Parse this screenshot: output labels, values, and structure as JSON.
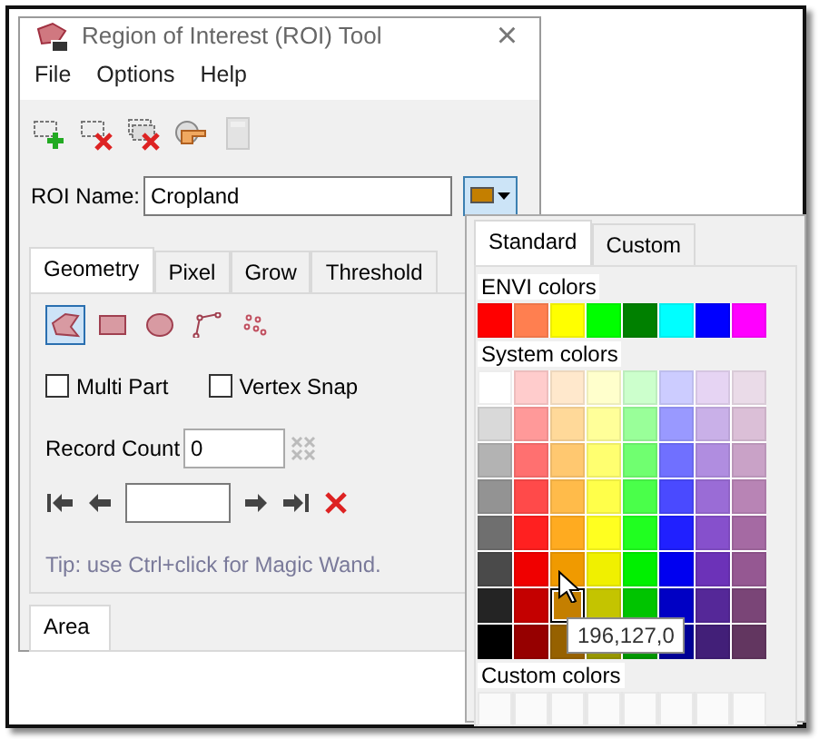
{
  "window": {
    "title": "Region of Interest (ROI) Tool",
    "close": "×"
  },
  "menu": [
    {
      "label": "File"
    },
    {
      "label": "Options"
    },
    {
      "label": "Help"
    }
  ],
  "toolbar": [
    {
      "kind": "new",
      "disabled": false
    },
    {
      "kind": "delete",
      "disabled": false
    },
    {
      "kind": "delete-all",
      "disabled": false
    },
    {
      "kind": "hand",
      "disabled": false
    },
    {
      "kind": "calculator",
      "disabled": true
    }
  ],
  "roi_name": {
    "label": "ROI Name:",
    "value": "Cropland",
    "color": "#c47f00"
  },
  "tabs": [
    {
      "label": "Geometry",
      "selected": true
    },
    {
      "label": "Pixel",
      "selected": false
    },
    {
      "label": "Grow",
      "selected": false
    },
    {
      "label": "Threshold",
      "selected": false
    }
  ],
  "geometry_tools": [
    {
      "kind": "polygon",
      "selected": true
    },
    {
      "kind": "rectangle",
      "selected": false
    },
    {
      "kind": "ellipse",
      "selected": false
    },
    {
      "kind": "polyline",
      "selected": false
    },
    {
      "kind": "point",
      "selected": false
    }
  ],
  "checkboxes": [
    {
      "label": "Multi Part",
      "checked": false
    },
    {
      "label": "Vertex Snap",
      "checked": false
    }
  ],
  "record_count": {
    "label": "Record Count",
    "value": "0"
  },
  "navigation": [
    {
      "kind": "first"
    },
    {
      "kind": "prev"
    },
    {
      "kind": "field"
    },
    {
      "kind": "next"
    },
    {
      "kind": "last"
    },
    {
      "kind": "delete"
    }
  ],
  "tip": "Tip: use Ctrl+click for Magic Wand.",
  "bottom_tabs": [
    {
      "label": "Area",
      "selected": true
    }
  ],
  "palette": {
    "tabs": [
      {
        "label": "Standard",
        "selected": true
      },
      {
        "label": "Custom",
        "selected": false
      }
    ],
    "envi_label": "ENVI colors",
    "envi_colors": [
      {
        "color": "#ff0000"
      },
      {
        "color": "#ff7f50"
      },
      {
        "color": "#ffff00"
      },
      {
        "color": "#00ff00"
      },
      {
        "color": "#008000"
      },
      {
        "color": "#00ffff"
      },
      {
        "color": "#0000ff"
      },
      {
        "color": "#ff00ff"
      }
    ],
    "system_label": "System colors",
    "system_colors": [
      [
        {
          "color": "#ffffff",
          "selected": false
        },
        {
          "color": "#ffcccc",
          "selected": false
        },
        {
          "color": "#ffe8cc",
          "selected": false
        },
        {
          "color": "#ffffcc",
          "selected": false
        },
        {
          "color": "#ccffcc",
          "selected": false
        },
        {
          "color": "#ccccff",
          "selected": false
        },
        {
          "color": "#e6d4f3",
          "selected": false
        },
        {
          "color": "#eadbe8",
          "selected": false
        }
      ],
      [
        {
          "color": "#d9d9d9",
          "selected": false
        },
        {
          "color": "#ff9999",
          "selected": false
        },
        {
          "color": "#ffd999",
          "selected": false
        },
        {
          "color": "#ffff99",
          "selected": false
        },
        {
          "color": "#99ff99",
          "selected": false
        },
        {
          "color": "#9999ff",
          "selected": false
        },
        {
          "color": "#c9b0e8",
          "selected": false
        },
        {
          "color": "#dbbfd7",
          "selected": false
        }
      ],
      [
        {
          "color": "#b3b3b3",
          "selected": false
        },
        {
          "color": "#ff7070",
          "selected": false
        },
        {
          "color": "#ffc870",
          "selected": false
        },
        {
          "color": "#ffff70",
          "selected": false
        },
        {
          "color": "#70ff70",
          "selected": false
        },
        {
          "color": "#7070ff",
          "selected": false
        },
        {
          "color": "#b08de0",
          "selected": false
        },
        {
          "color": "#c9a2c7",
          "selected": false
        }
      ],
      [
        {
          "color": "#939393",
          "selected": false
        },
        {
          "color": "#ff4a4a",
          "selected": false
        },
        {
          "color": "#ffbb4a",
          "selected": false
        },
        {
          "color": "#ffff4a",
          "selected": false
        },
        {
          "color": "#4aff4a",
          "selected": false
        },
        {
          "color": "#4a4aff",
          "selected": false
        },
        {
          "color": "#9a6cd6",
          "selected": false
        },
        {
          "color": "#b884b5",
          "selected": false
        }
      ],
      [
        {
          "color": "#6f6f6f",
          "selected": false
        },
        {
          "color": "#ff2020",
          "selected": false
        },
        {
          "color": "#ffab20",
          "selected": false
        },
        {
          "color": "#ffff20",
          "selected": false
        },
        {
          "color": "#20ff20",
          "selected": false
        },
        {
          "color": "#2020ff",
          "selected": false
        },
        {
          "color": "#8650cc",
          "selected": false
        },
        {
          "color": "#a56aa3",
          "selected": false
        }
      ],
      [
        {
          "color": "#4a4a4a",
          "selected": false
        },
        {
          "color": "#f00000",
          "selected": false
        },
        {
          "color": "#f09a00",
          "selected": false
        },
        {
          "color": "#f0f000",
          "selected": false
        },
        {
          "color": "#00f000",
          "selected": false
        },
        {
          "color": "#0000f0",
          "selected": false
        },
        {
          "color": "#6c32b8",
          "selected": false
        },
        {
          "color": "#955892",
          "selected": false
        }
      ],
      [
        {
          "color": "#242424",
          "selected": false
        },
        {
          "color": "#c40000",
          "selected": false
        },
        {
          "color": "#c47f00",
          "selected": true
        },
        {
          "color": "#c4c400",
          "selected": false
        },
        {
          "color": "#00c400",
          "selected": false
        },
        {
          "color": "#0000c4",
          "selected": false
        },
        {
          "color": "#552898",
          "selected": false
        },
        {
          "color": "#7a4577",
          "selected": false
        }
      ],
      [
        {
          "color": "#000000",
          "selected": false
        },
        {
          "color": "#960000",
          "selected": false
        },
        {
          "color": "#966100",
          "selected": false
        },
        {
          "color": "#969600",
          "selected": false
        },
        {
          "color": "#009600",
          "selected": false
        },
        {
          "color": "#000096",
          "selected": false
        },
        {
          "color": "#421f78",
          "selected": false
        },
        {
          "color": "#623660",
          "selected": false
        }
      ]
    ],
    "tooltip": "196,127,0",
    "custom_label": "Custom colors",
    "custom_colors": [
      {
        "color": "#fafafa"
      },
      {
        "color": "#fafafa"
      },
      {
        "color": "#fafafa"
      },
      {
        "color": "#fafafa"
      },
      {
        "color": "#fafafa"
      },
      {
        "color": "#fafafa"
      },
      {
        "color": "#fafafa"
      },
      {
        "color": "#fafafa"
      }
    ]
  }
}
